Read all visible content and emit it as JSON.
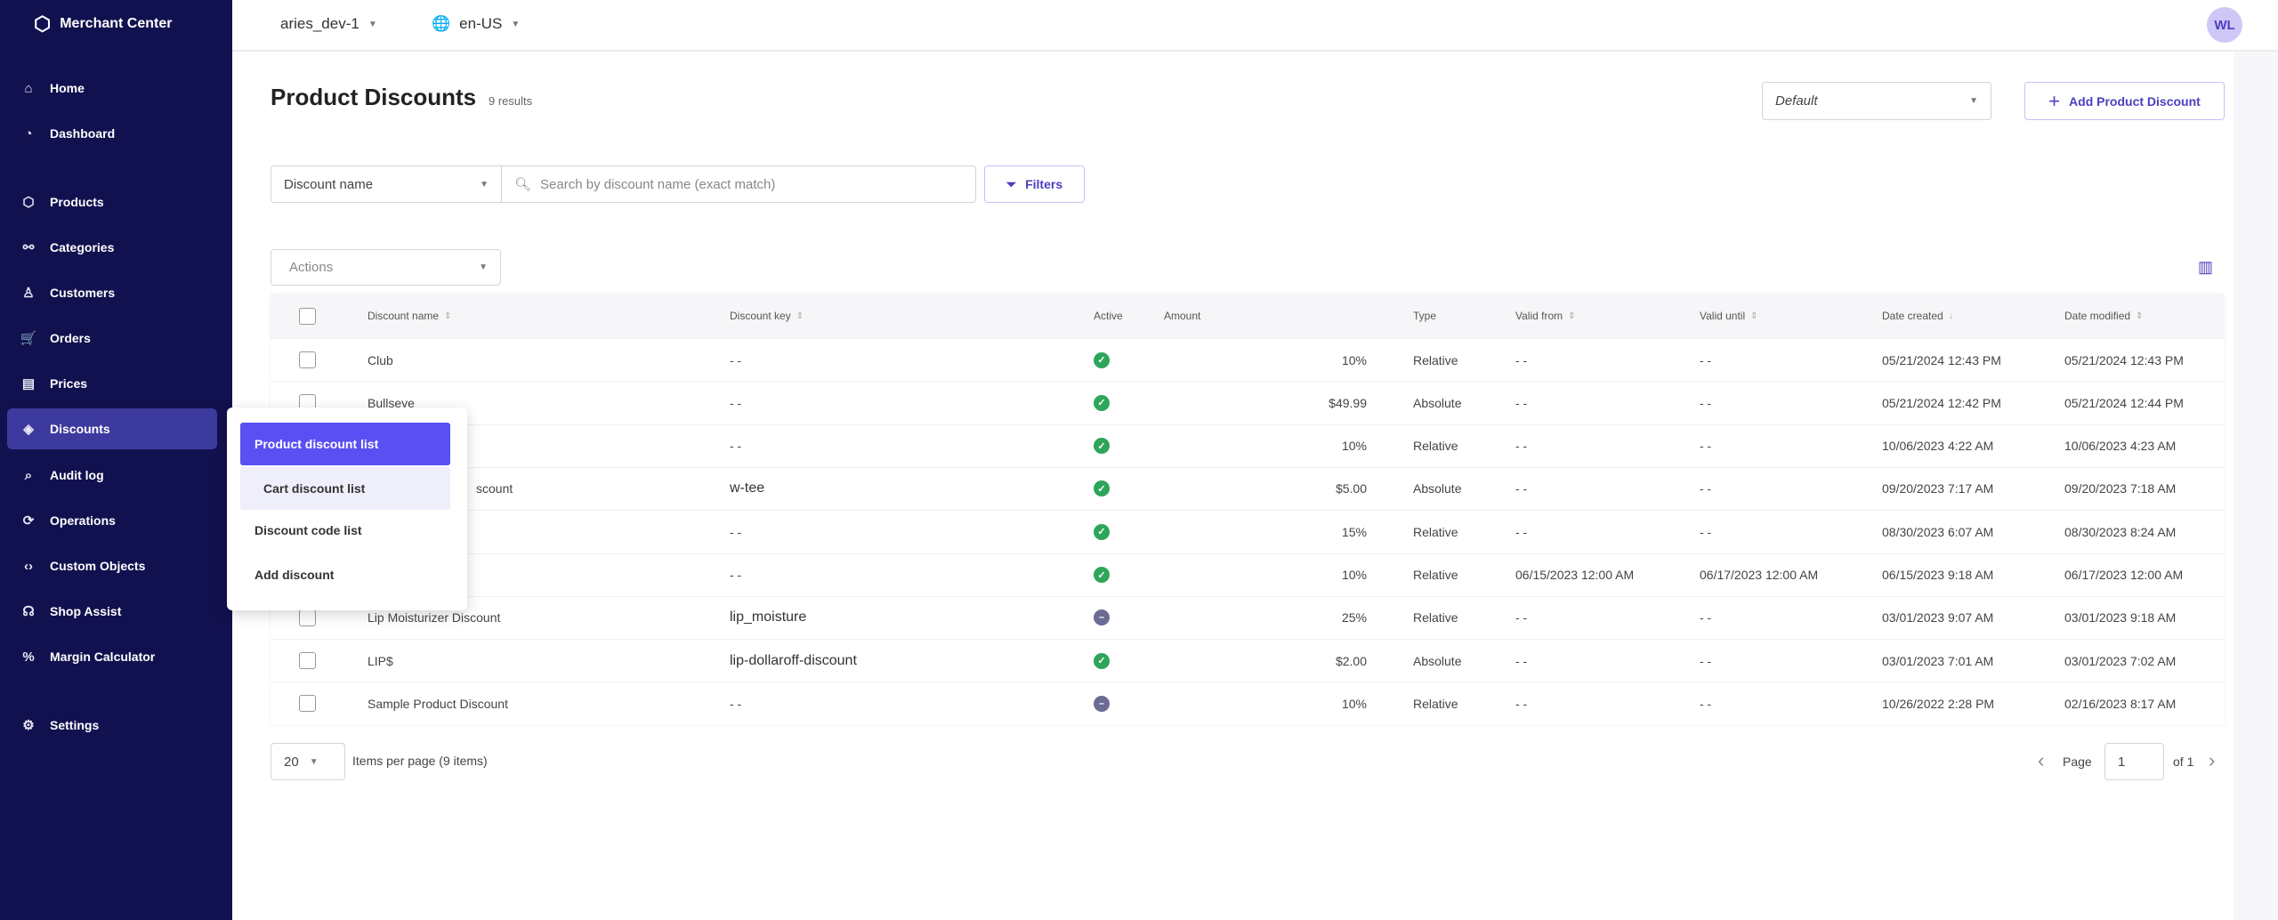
{
  "app": {
    "title": "Merchant Center",
    "logo_icon": "cube-icon"
  },
  "header": {
    "project": "aries_dev-1",
    "locale": "en-US",
    "avatar": "WL"
  },
  "sidebar": {
    "items": [
      {
        "label": "Home",
        "icon": "⌂"
      },
      {
        "label": "Dashboard",
        "icon": "◔"
      },
      {
        "label": "Products",
        "icon": "⬡"
      },
      {
        "label": "Categories",
        "icon": "⚯"
      },
      {
        "label": "Customers",
        "icon": "♙"
      },
      {
        "label": "Orders",
        "icon": "🛒"
      },
      {
        "label": "Prices",
        "icon": "▤"
      },
      {
        "label": "Discounts",
        "icon": "◈",
        "active": true
      },
      {
        "label": "Audit log",
        "icon": "⌕"
      },
      {
        "label": "Operations",
        "icon": "⟳"
      },
      {
        "label": "Custom Objects",
        "icon": "‹›"
      },
      {
        "label": "Shop Assist",
        "icon": "☊"
      },
      {
        "label": "Margin Calculator",
        "icon": "%"
      },
      {
        "label": "Settings",
        "icon": "⚙"
      }
    ]
  },
  "discounts_menu": {
    "items": [
      "Product discount list",
      "Cart discount list",
      "Discount code list",
      "Add discount"
    ],
    "selected": "Product discount list",
    "hovered": "Cart discount list"
  },
  "page": {
    "title": "Product Discounts",
    "results": "9 results",
    "view_select": "Default",
    "add_button": "Add Product Discount"
  },
  "search": {
    "field_select": "Discount name",
    "placeholder": "Search by discount name (exact match)",
    "filters_button": "Filters"
  },
  "actions": {
    "label": "Actions"
  },
  "table": {
    "columns": [
      "Discount name",
      "Discount key",
      "Active",
      "Amount",
      "Type",
      "Valid from",
      "Valid until",
      "Date created",
      "Date modified"
    ],
    "rows": [
      {
        "name": "Club",
        "key": "- -",
        "active": true,
        "amount": "10%",
        "type": "Relative",
        "from": "- -",
        "until": "- -",
        "created": "05/21/2024 12:43 PM",
        "modified": "05/21/2024 12:43 PM"
      },
      {
        "name": "Bullseye",
        "key": "- -",
        "active": true,
        "amount": "$49.99",
        "type": "Absolute",
        "from": "- -",
        "until": "- -",
        "created": "05/21/2024 12:42 PM",
        "modified": "05/21/2024 12:44 PM"
      },
      {
        "name": "",
        "key": "- -",
        "active": true,
        "amount": "10%",
        "type": "Relative",
        "from": "- -",
        "until": "- -",
        "created": "10/06/2023 4:22 AM",
        "modified": "10/06/2023 4:23 AM"
      },
      {
        "name": "scount",
        "key": "w-tee",
        "active": true,
        "amount": "$5.00",
        "type": "Absolute",
        "from": "- -",
        "until": "- -",
        "created": "09/20/2023 7:17 AM",
        "modified": "09/20/2023 7:18 AM"
      },
      {
        "name": "",
        "key": "- -",
        "active": true,
        "amount": "15%",
        "type": "Relative",
        "from": "- -",
        "until": "- -",
        "created": "08/30/2023 6:07 AM",
        "modified": "08/30/2023 8:24 AM"
      },
      {
        "name": "",
        "key": "- -",
        "active": true,
        "amount": "10%",
        "type": "Relative",
        "from": "06/15/2023 12:00 AM",
        "until": "06/17/2023 12:00 AM",
        "created": "06/15/2023 9:18 AM",
        "modified": "06/17/2023 12:00 AM"
      },
      {
        "name": "Lip Moisturizer Discount",
        "key": "lip_moisture",
        "active": false,
        "amount": "25%",
        "type": "Relative",
        "from": "- -",
        "until": "- -",
        "created": "03/01/2023 9:07 AM",
        "modified": "03/01/2023 9:18 AM"
      },
      {
        "name": "LIP$",
        "key": "lip-dollaroff-discount",
        "active": true,
        "amount": "$2.00",
        "type": "Absolute",
        "from": "- -",
        "until": "- -",
        "created": "03/01/2023 7:01 AM",
        "modified": "03/01/2023 7:02 AM"
      },
      {
        "name": "Sample Product Discount",
        "key": "- -",
        "active": false,
        "amount": "10%",
        "type": "Relative",
        "from": "- -",
        "until": "- -",
        "created": "10/26/2022 2:28 PM",
        "modified": "02/16/2023 8:17 AM"
      }
    ]
  },
  "pagination": {
    "per_page": "20",
    "per_page_label": "Items per page (9 items)",
    "page_label": "Page",
    "page": "1",
    "of": "of 1"
  },
  "colors": {
    "sidebar": "#12114f",
    "accent": "#5a4ff3",
    "active_green": "#2ea55a",
    "inactive": "#6b6b94"
  }
}
